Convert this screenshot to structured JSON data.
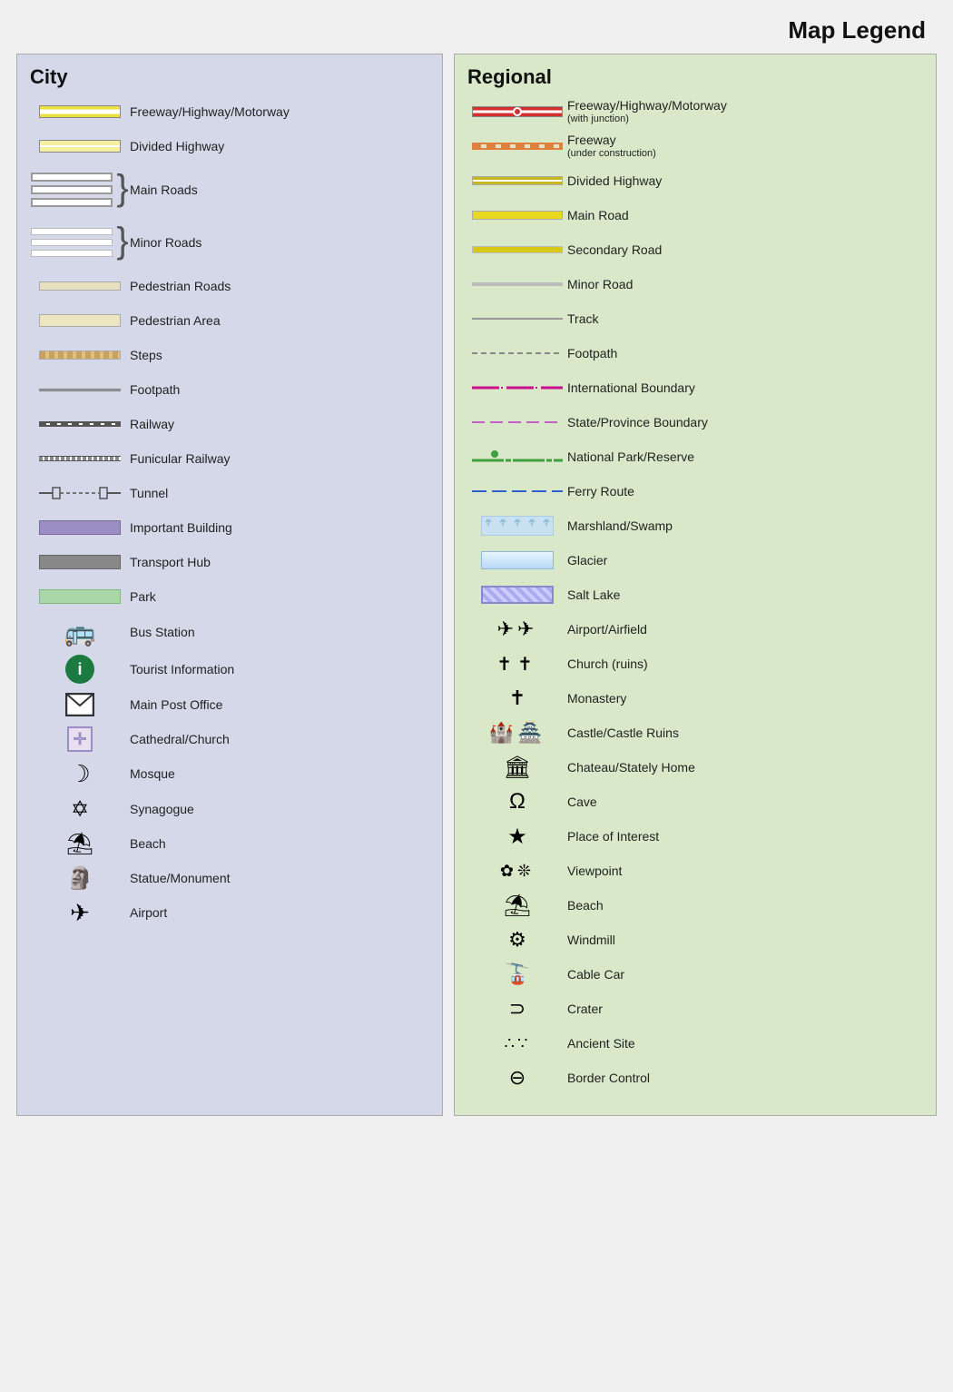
{
  "title": "Map Legend",
  "city": {
    "heading": "City",
    "items": [
      {
        "id": "freeway",
        "label": "Freeway/Highway/Motorway",
        "symbol": "freeway"
      },
      {
        "id": "divided-hwy",
        "label": "Divided Highway",
        "symbol": "divided-hwy"
      },
      {
        "id": "main-roads",
        "label": "Main Roads",
        "symbol": "main-roads"
      },
      {
        "id": "minor-roads",
        "label": "Minor Roads",
        "symbol": "minor-roads"
      },
      {
        "id": "pedestrian-roads",
        "label": "Pedestrian Roads",
        "symbol": "pedestrian-roads"
      },
      {
        "id": "pedestrian-area",
        "label": "Pedestrian Area",
        "symbol": "pedestrian-area"
      },
      {
        "id": "steps",
        "label": "Steps",
        "symbol": "steps"
      },
      {
        "id": "footpath",
        "label": "Footpath",
        "symbol": "footpath"
      },
      {
        "id": "railway",
        "label": "Railway",
        "symbol": "railway"
      },
      {
        "id": "funicular",
        "label": "Funicular Railway",
        "symbol": "funicular"
      },
      {
        "id": "tunnel",
        "label": "Tunnel",
        "symbol": "tunnel"
      },
      {
        "id": "important-building",
        "label": "Important Building",
        "symbol": "important-building"
      },
      {
        "id": "transport-hub",
        "label": "Transport Hub",
        "symbol": "transport-hub"
      },
      {
        "id": "park",
        "label": "Park",
        "symbol": "park"
      },
      {
        "id": "bus-station",
        "label": "Bus Station",
        "symbol": "bus-station"
      },
      {
        "id": "tourist-info",
        "label": "Tourist Information",
        "symbol": "tourist-info"
      },
      {
        "id": "post-office",
        "label": "Main Post Office",
        "symbol": "post-office"
      },
      {
        "id": "cathedral",
        "label": "Cathedral/Church",
        "symbol": "cathedral"
      },
      {
        "id": "mosque",
        "label": "Mosque",
        "symbol": "mosque"
      },
      {
        "id": "synagogue",
        "label": "Synagogue",
        "symbol": "synagogue"
      },
      {
        "id": "beach-city",
        "label": "Beach",
        "symbol": "beach-city"
      },
      {
        "id": "statue",
        "label": "Statue/Monument",
        "symbol": "statue"
      },
      {
        "id": "airport-city",
        "label": "Airport",
        "symbol": "airport-city"
      }
    ]
  },
  "regional": {
    "heading": "Regional",
    "items": [
      {
        "id": "reg-freeway",
        "label": "Freeway/Highway/Motorway",
        "sublabel": "(with junction)",
        "symbol": "reg-freeway"
      },
      {
        "id": "reg-freeway-const",
        "label": "Freeway",
        "sublabel": "(under construction)",
        "symbol": "reg-freeway-const"
      },
      {
        "id": "reg-divided",
        "label": "Divided Highway",
        "symbol": "reg-divided"
      },
      {
        "id": "reg-main",
        "label": "Main Road",
        "symbol": "reg-main"
      },
      {
        "id": "reg-secondary",
        "label": "Secondary Road",
        "symbol": "reg-secondary"
      },
      {
        "id": "reg-minor",
        "label": "Minor Road",
        "symbol": "reg-minor"
      },
      {
        "id": "reg-track",
        "label": "Track",
        "symbol": "reg-track"
      },
      {
        "id": "reg-footpath",
        "label": "Footpath",
        "symbol": "reg-footpath"
      },
      {
        "id": "reg-intl-boundary",
        "label": "International Boundary",
        "symbol": "reg-intl-boundary"
      },
      {
        "id": "reg-state-boundary",
        "label": "State/Province Boundary",
        "symbol": "reg-state-boundary"
      },
      {
        "id": "reg-nat-park",
        "label": "National Park/Reserve",
        "symbol": "reg-nat-park"
      },
      {
        "id": "reg-ferry",
        "label": "Ferry Route",
        "symbol": "reg-ferry"
      },
      {
        "id": "reg-marshland",
        "label": "Marshland/Swamp",
        "symbol": "reg-marshland"
      },
      {
        "id": "reg-glacier",
        "label": "Glacier",
        "symbol": "reg-glacier"
      },
      {
        "id": "reg-salt-lake",
        "label": "Salt Lake",
        "symbol": "reg-salt-lake"
      },
      {
        "id": "reg-airport",
        "label": "Airport/Airfield",
        "symbol": "reg-airport"
      },
      {
        "id": "reg-church",
        "label": "Church (ruins)",
        "symbol": "reg-church"
      },
      {
        "id": "reg-monastery",
        "label": "Monastery",
        "symbol": "reg-monastery"
      },
      {
        "id": "reg-castle",
        "label": "Castle/Castle Ruins",
        "symbol": "reg-castle"
      },
      {
        "id": "reg-chateau",
        "label": "Chateau/Stately Home",
        "symbol": "reg-chateau"
      },
      {
        "id": "reg-cave",
        "label": "Cave",
        "symbol": "reg-cave"
      },
      {
        "id": "reg-poi",
        "label": "Place of Interest",
        "symbol": "reg-poi"
      },
      {
        "id": "reg-viewpoint",
        "label": "Viewpoint",
        "symbol": "reg-viewpoint"
      },
      {
        "id": "reg-beach",
        "label": "Beach",
        "symbol": "reg-beach"
      },
      {
        "id": "reg-windmill",
        "label": "Windmill",
        "symbol": "reg-windmill"
      },
      {
        "id": "reg-cablecar",
        "label": "Cable Car",
        "symbol": "reg-cablecar"
      },
      {
        "id": "reg-crater",
        "label": "Crater",
        "symbol": "reg-crater"
      },
      {
        "id": "reg-ancient",
        "label": "Ancient Site",
        "symbol": "reg-ancient"
      },
      {
        "id": "reg-border",
        "label": "Border Control",
        "symbol": "reg-border"
      }
    ]
  }
}
